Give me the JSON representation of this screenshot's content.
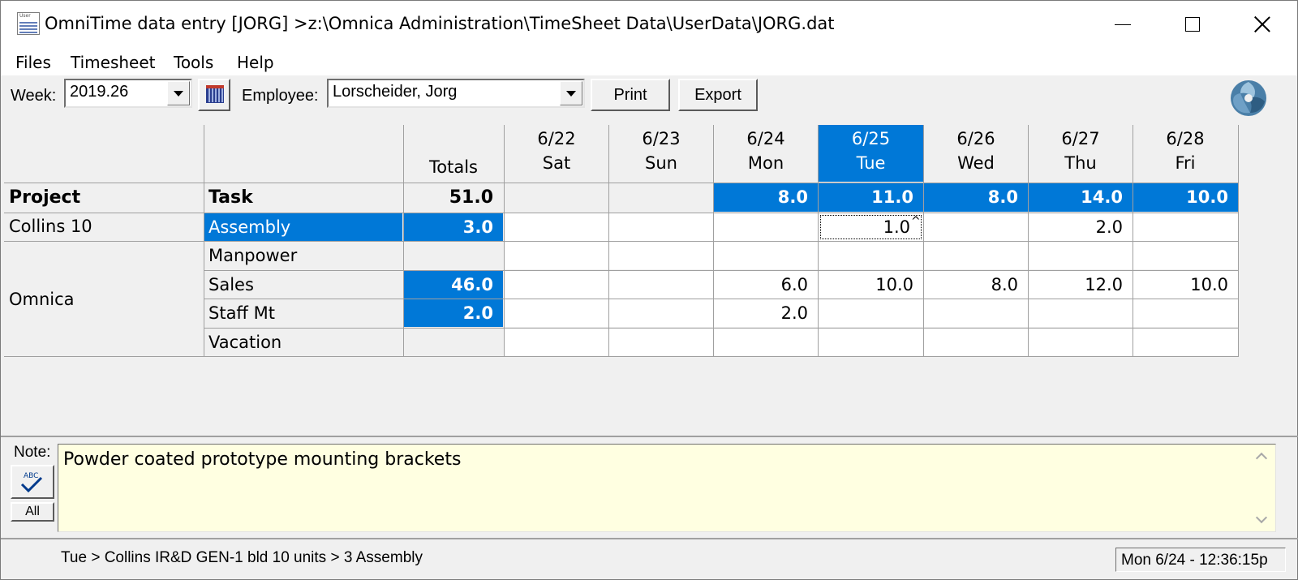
{
  "window": {
    "title": "OmniTime data entry [JORG] >z:\\Omnica Administration\\TimeSheet Data\\UserData\\JORG.dat",
    "icon_label": "User"
  },
  "menu": [
    "Files",
    "Timesheet",
    "Tools",
    "Help"
  ],
  "toolbar": {
    "week_label": "Week:",
    "week_value": "2019.26",
    "employee_label": "Employee:",
    "employee_value": "Lorscheider, Jorg",
    "print_label": "Print",
    "export_label": "Export"
  },
  "grid": {
    "totals_header": "Totals",
    "project_header": "Project",
    "task_header": "Task",
    "grand_total": "51.0",
    "days": [
      {
        "date": "6/22",
        "day": "Sat",
        "total": ""
      },
      {
        "date": "6/23",
        "day": "Sun",
        "total": ""
      },
      {
        "date": "6/24",
        "day": "Mon",
        "total": "8.0"
      },
      {
        "date": "6/25",
        "day": "Tue",
        "total": "11.0"
      },
      {
        "date": "6/26",
        "day": "Wed",
        "total": "8.0"
      },
      {
        "date": "6/27",
        "day": "Thu",
        "total": "14.0"
      },
      {
        "date": "6/28",
        "day": "Fri",
        "total": "10.0"
      }
    ],
    "projects": [
      "Collins 10",
      "Omnica"
    ],
    "rows": [
      {
        "task": "Assembly",
        "total": "3.0",
        "values": [
          "",
          "",
          "",
          "1.0",
          "",
          "2.0",
          ""
        ]
      },
      {
        "task": "Manpower",
        "total": "",
        "values": [
          "",
          "",
          "",
          "",
          "",
          "",
          ""
        ]
      },
      {
        "task": "Sales",
        "total": "46.0",
        "values": [
          "",
          "",
          "6.0",
          "10.0",
          "8.0",
          "12.0",
          "10.0"
        ]
      },
      {
        "task": "Staff Mt",
        "total": "2.0",
        "values": [
          "",
          "",
          "2.0",
          "",
          "",
          "",
          ""
        ]
      },
      {
        "task": "Vacation",
        "total": "",
        "values": [
          "",
          "",
          "",
          "",
          "",
          "",
          ""
        ]
      }
    ]
  },
  "note": {
    "label": "Note:",
    "text": "Powder coated prototype mounting brackets",
    "all_label": "All",
    "spell_label": "ABC"
  },
  "status": {
    "path": "Tue > Collins IR&D GEN-1 bld 10 units > 3 Assembly",
    "time": "Mon 6/24 - 12:36:15p"
  },
  "colors": {
    "highlight": "#0078d7",
    "note_bg": "#ffffe1",
    "window_bg": "#f0f0f0"
  }
}
